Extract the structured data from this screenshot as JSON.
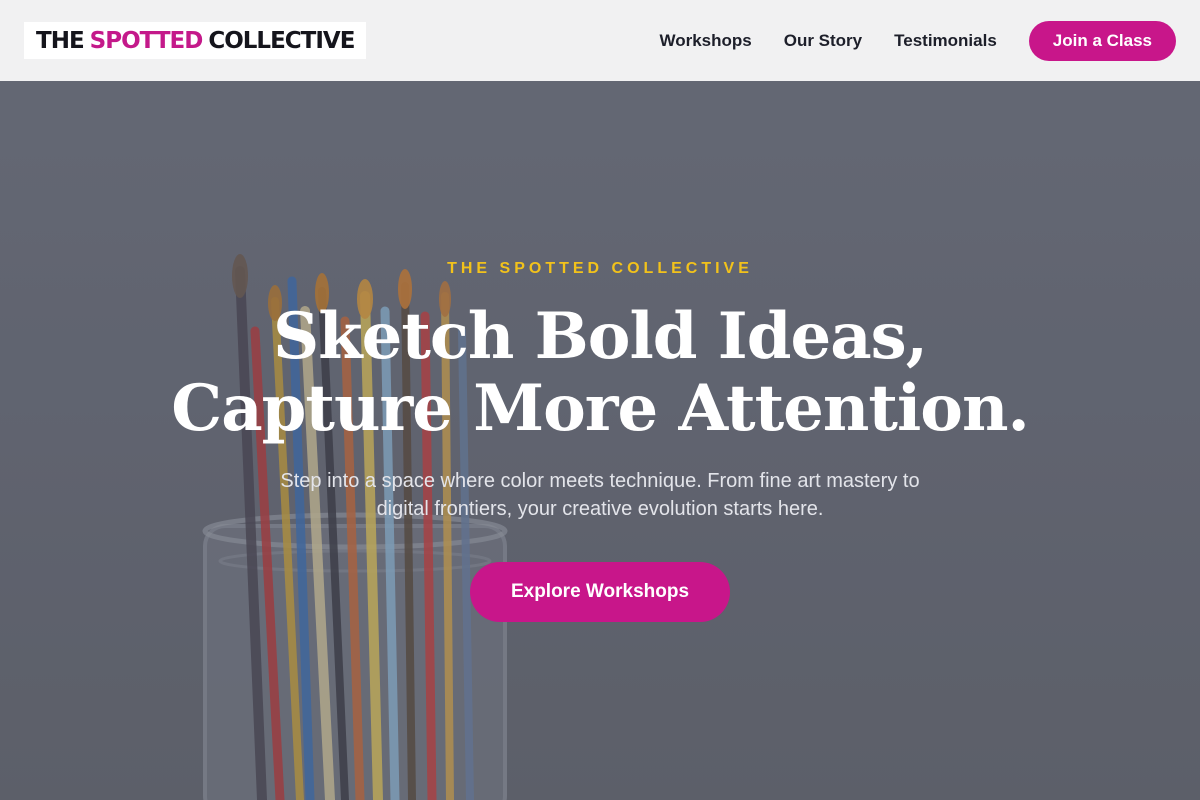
{
  "header": {
    "logo": {
      "prefix": "THE",
      "accent": "SPOTTED",
      "suffix": "COLLECTIVE"
    },
    "nav": [
      "Workshops",
      "Our Story",
      "Testimonials"
    ],
    "cta_label": "Join a Class"
  },
  "hero": {
    "eyebrow": "THE SPOTTED COLLECTIVE",
    "headline_line1": "Sketch Bold Ideas,",
    "headline_line2": "Capture More Attention.",
    "subtext": "Step into a space where color meets technique. From fine art mastery to digital frontiers, your creative evolution starts here.",
    "cta_label": "Explore Workshops",
    "background_image": "paintbrushes-in-glass-jar"
  },
  "colors": {
    "accent": "#c8168a",
    "eyebrow": "#f2c21b",
    "header_bg": "#f1f1f2",
    "hero_bg": "#6b6f7b"
  }
}
